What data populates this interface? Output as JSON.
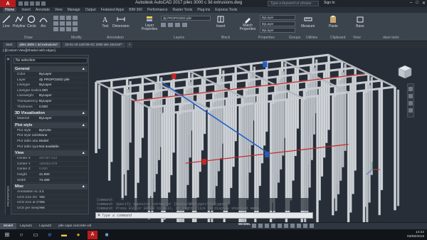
{
  "window": {
    "title": "Autodesk AutoCAD 2017   piles 3000 c 3d extrusions.dwg",
    "search_placeholder": "Type a keyword or phrase",
    "signin": "Sign In",
    "app_letter": "A"
  },
  "ribbon_tabs": [
    "Home",
    "Insert",
    "Annotate",
    "View",
    "Manage",
    "Output",
    "Featured Apps",
    "BIM 360",
    "Performance",
    "Raster Tools",
    "Plug-ins",
    "Express Tools"
  ],
  "ribbon": {
    "draw_buttons": [
      "Line",
      "Polyline",
      "Circle",
      "Arc"
    ],
    "modify_label": "Modify",
    "text_label": "Text",
    "dimension_label": "Dimension",
    "layer_properties_label": "Layer Properties",
    "layer_value": "dp PROPOSED pile",
    "insert_label": "Insert",
    "match_label": "Match Properties",
    "bylayer1": "ByLayer",
    "bylayer2": "ByLayer",
    "bylayer3": "ByLayer",
    "measure_label": "Measure",
    "paste_label": "Paste",
    "base_label": "Base",
    "panels": [
      "Draw",
      "Modify",
      "Annotation",
      "Layers",
      "Block",
      "Properties",
      "Groups",
      "Utilities",
      "Clipboard",
      "View"
    ],
    "dave_tools": "dave tools"
  },
  "file_tabs": [
    "Start",
    "piles 3000 c 3d extrusions*",
    "23-01-19 125729-XC 2000 site 2mm10'*"
  ],
  "viewport_label": "[-][Custom View][Shaded with edges]",
  "properties": {
    "selection": "No selection",
    "side_label": "PROPERTIES",
    "sections": [
      {
        "title": "General",
        "rows": [
          [
            "Color",
            "ByLayer"
          ],
          [
            "Layer",
            "dp PROPOSED pile"
          ],
          [
            "Linetype",
            "ByLayer"
          ],
          [
            "Linetype scale",
            "1.000"
          ],
          [
            "Lineweight",
            "ByLayer"
          ],
          [
            "Transparency",
            "ByLayer"
          ],
          [
            "Thickness",
            "0.000"
          ]
        ]
      },
      {
        "title": "3D Visualization",
        "rows": [
          [
            "Material",
            "ByLayer"
          ]
        ]
      },
      {
        "title": "Plot style",
        "rows": [
          [
            "Plot style",
            "ByColor"
          ],
          [
            "Plot style table",
            "None"
          ],
          [
            "Plot table atta...",
            "Model"
          ],
          [
            "Plot table type",
            "Not available"
          ]
        ]
      },
      {
        "title": "View",
        "rows": [
          [
            "Center X",
            "487297.912"
          ],
          [
            "Center Y",
            "185592.679"
          ],
          [
            "Center Z",
            "0.000"
          ],
          [
            "Height",
            "41.900"
          ],
          [
            "Width",
            "74.468"
          ]
        ]
      },
      {
        "title": "Misc",
        "rows": [
          [
            "Annotation sc...",
            "1:1"
          ],
          [
            "UCS icon On",
            "Yes"
          ],
          [
            "UCS icon at Or...",
            "Yes"
          ],
          [
            "UCS per viewp...",
            "Yes"
          ]
        ]
      }
    ]
  },
  "command": {
    "history": [
      "Command:",
      "Command: Specify opposite corner or [Fence/WPolygon/CPolygon]:",
      "Command: Press ESC or ENTER to exit, or right-click to display shortcut menu."
    ],
    "prompt": "Type a command"
  },
  "status": {
    "tabs": [
      "Model",
      "Layout1",
      "Layout2",
      "pile caps concrete vol"
    ],
    "model": "MODEL"
  },
  "taskbar": {
    "time": "14:22",
    "date": "03/06/2019"
  },
  "colors": {
    "accent": "#b71c1c",
    "pile": "#cfd3d8",
    "beam_red": "#c62828",
    "beam_blue": "#1e5fc8"
  }
}
